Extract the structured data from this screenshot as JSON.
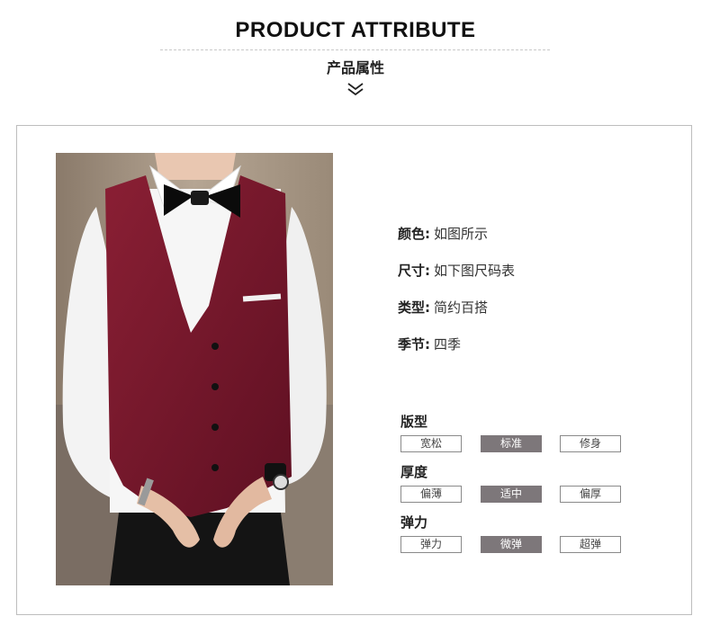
{
  "header": {
    "title_en": "PRODUCT ATTRIBUTE",
    "title_cn": "产品属性",
    "chevron_icon": "double-chevron-down-icon"
  },
  "photo": {
    "subject": "model wearing wine-red vest over white shirt with black bow tie"
  },
  "attributes": [
    {
      "label": "颜色:",
      "value": "如图所示"
    },
    {
      "label": "尺寸:",
      "value": "如下图尺码表"
    },
    {
      "label": "类型:",
      "value": "简约百搭"
    },
    {
      "label": "季节:",
      "value": "四季"
    }
  ],
  "groups": [
    {
      "title": "版型",
      "options": [
        "宽松",
        "标准",
        "修身"
      ],
      "selected": 1
    },
    {
      "title": "厚度",
      "options": [
        "偏薄",
        "适中",
        "偏厚"
      ],
      "selected": 1
    },
    {
      "title": "弹力",
      "options": [
        "弹力",
        "微弹",
        "超弹"
      ],
      "selected": 1
    }
  ],
  "colors": {
    "selected_bg": "#7d777a",
    "vest": "#7a1a2e",
    "frame_border": "#bdbdbd"
  }
}
